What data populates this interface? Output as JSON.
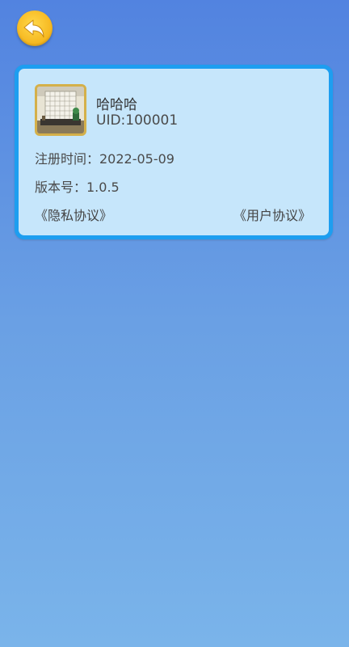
{
  "back_button": {
    "icon": "back-arrow-icon",
    "color": "#f5b51d"
  },
  "profile": {
    "avatar": "chessboard-avatar-image",
    "nickname": "哈哈哈",
    "uid": "UID:100001",
    "register_time": "注册时间：2022-05-09",
    "version": "版本号：1.0.5"
  },
  "links": {
    "privacy": "《隐私协议》",
    "user_agreement": "《用户协议》"
  },
  "colors": {
    "card_border": "#1d9ef0",
    "card_background": "#c6e6fb",
    "background_top": "#5283e0",
    "background_bottom": "#7ab4ea"
  }
}
